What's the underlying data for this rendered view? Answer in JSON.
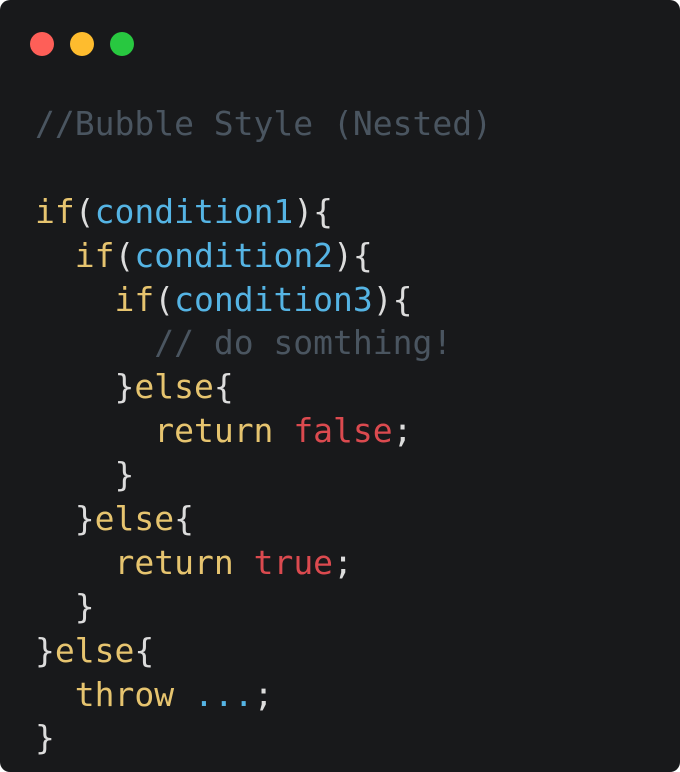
{
  "window": {
    "background": "#18191b",
    "controls": [
      {
        "name": "close-dot",
        "color": "#fe5f58"
      },
      {
        "name": "minimize-dot",
        "color": "#febc2e"
      },
      {
        "name": "zoom-dot",
        "color": "#28c840"
      }
    ]
  },
  "colors": {
    "comment": "#4a5560",
    "keyword": "#e6c46f",
    "identifier": "#55b4e4",
    "punct": "#dcdcdc",
    "literal": "#db4a4f"
  },
  "code": {
    "lines": [
      {
        "tokens": [
          {
            "t": "//Bubble Style (Nested)",
            "k": "comment"
          }
        ]
      },
      {
        "tokens": []
      },
      {
        "tokens": [
          {
            "t": "if",
            "k": "keyword"
          },
          {
            "t": "(",
            "k": "punct"
          },
          {
            "t": "condition1",
            "k": "identifier"
          },
          {
            "t": "){",
            "k": "punct"
          }
        ]
      },
      {
        "tokens": [
          {
            "t": "  ",
            "k": "punct"
          },
          {
            "t": "if",
            "k": "keyword"
          },
          {
            "t": "(",
            "k": "punct"
          },
          {
            "t": "condition2",
            "k": "identifier"
          },
          {
            "t": "){",
            "k": "punct"
          }
        ]
      },
      {
        "tokens": [
          {
            "t": "    ",
            "k": "punct"
          },
          {
            "t": "if",
            "k": "keyword"
          },
          {
            "t": "(",
            "k": "punct"
          },
          {
            "t": "condition3",
            "k": "identifier"
          },
          {
            "t": "){",
            "k": "punct"
          }
        ]
      },
      {
        "tokens": [
          {
            "t": "      ",
            "k": "punct"
          },
          {
            "t": "// do somthing!",
            "k": "comment"
          }
        ]
      },
      {
        "tokens": [
          {
            "t": "    ",
            "k": "punct"
          },
          {
            "t": "}",
            "k": "punct"
          },
          {
            "t": "else",
            "k": "keyword"
          },
          {
            "t": "{",
            "k": "punct"
          }
        ]
      },
      {
        "tokens": [
          {
            "t": "      ",
            "k": "punct"
          },
          {
            "t": "return",
            "k": "keyword"
          },
          {
            "t": " ",
            "k": "punct"
          },
          {
            "t": "false",
            "k": "literal"
          },
          {
            "t": ";",
            "k": "punct"
          }
        ]
      },
      {
        "tokens": [
          {
            "t": "    ",
            "k": "punct"
          },
          {
            "t": "}",
            "k": "punct"
          }
        ]
      },
      {
        "tokens": [
          {
            "t": "  ",
            "k": "punct"
          },
          {
            "t": "}",
            "k": "punct"
          },
          {
            "t": "else",
            "k": "keyword"
          },
          {
            "t": "{",
            "k": "punct"
          }
        ]
      },
      {
        "tokens": [
          {
            "t": "    ",
            "k": "punct"
          },
          {
            "t": "return",
            "k": "keyword"
          },
          {
            "t": " ",
            "k": "punct"
          },
          {
            "t": "true",
            "k": "literal"
          },
          {
            "t": ";",
            "k": "punct"
          }
        ]
      },
      {
        "tokens": [
          {
            "t": "  ",
            "k": "punct"
          },
          {
            "t": "}",
            "k": "punct"
          }
        ]
      },
      {
        "tokens": [
          {
            "t": "}",
            "k": "punct"
          },
          {
            "t": "else",
            "k": "keyword"
          },
          {
            "t": "{",
            "k": "punct"
          }
        ]
      },
      {
        "tokens": [
          {
            "t": "  ",
            "k": "punct"
          },
          {
            "t": "throw",
            "k": "keyword"
          },
          {
            "t": " ",
            "k": "punct"
          },
          {
            "t": "...",
            "k": "identifier"
          },
          {
            "t": ";",
            "k": "punct"
          }
        ]
      },
      {
        "tokens": [
          {
            "t": "}",
            "k": "punct"
          }
        ]
      }
    ]
  }
}
